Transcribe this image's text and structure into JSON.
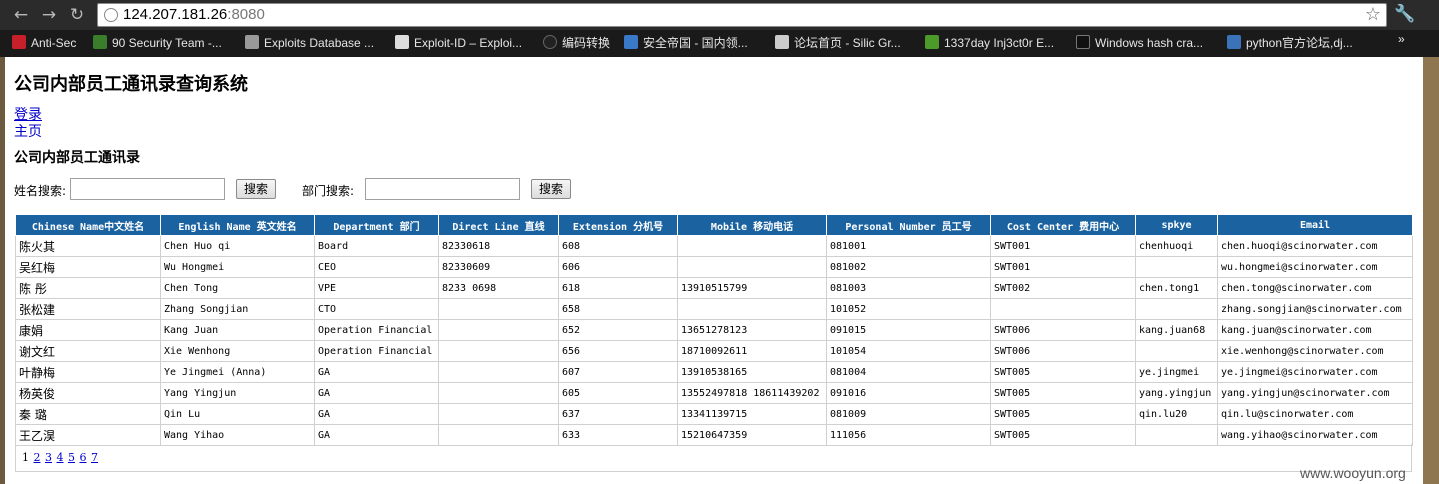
{
  "browser": {
    "url_host": "124.207.181.26",
    "url_port": ":8080",
    "bookmarks": [
      {
        "label": "Anti-Sec",
        "color": "#c8202a"
      },
      {
        "label": "90 Security Team -...",
        "color": "#3a7d2a"
      },
      {
        "label": "Exploits Database ...",
        "color": "#999999"
      },
      {
        "label": "Exploit-ID – Exploi...",
        "color": "#dddddd"
      },
      {
        "label": "编码转换",
        "color": "#222222"
      },
      {
        "label": "安全帝国 - 国内领...",
        "color": "#3a78c8"
      },
      {
        "label": "论坛首页 - Silic Gr...",
        "color": "#cccccc"
      },
      {
        "label": "1337day Inj3ct0r E...",
        "color": "#4c9a2a"
      },
      {
        "label": "Windows hash cra...",
        "color": "#111111"
      },
      {
        "label": "python官方论坛,dj...",
        "color": "#3b73b8"
      }
    ],
    "more": "»"
  },
  "page": {
    "title": "公司内部员工通讯录查询系统",
    "login_link": "登录",
    "home_link": "主页",
    "subtitle": "公司内部员工通讯录",
    "name_search_label": "姓名搜索:",
    "dept_search_label": "部门搜索:",
    "search_button": "搜索",
    "search_button2": "搜索"
  },
  "table": {
    "headers": [
      "Chinese Name中文姓名",
      "English Name 英文姓名",
      "Department 部门",
      "Direct Line 直线",
      "Extension 分机号",
      "Mobile 移动电话",
      "Personal Number 员工号",
      "Cost Center 费用中心",
      "spkye",
      "Email"
    ],
    "rows": [
      [
        "陈火其",
        "Chen Huo qi",
        "Board",
        "82330618",
        "608",
        "",
        "081001",
        "SWT001",
        "chenhuoqi",
        "chen.huoqi@scinorwater.com"
      ],
      [
        "吴红梅",
        "Wu Hongmei",
        "CEO",
        "82330609",
        "606",
        "",
        "081002",
        "SWT001",
        "",
        "wu.hongmei@scinorwater.com"
      ],
      [
        "陈 彤",
        "Chen Tong",
        "VPE",
        "8233 0698",
        "618",
        "13910515799",
        "081003",
        "SWT002",
        "chen.tong1",
        "chen.tong@scinorwater.com"
      ],
      [
        "张松建",
        "Zhang Songjian",
        "CTO",
        "",
        "658",
        "",
        "101052",
        "",
        "",
        "zhang.songjian@scinorwater.com"
      ],
      [
        "康娟",
        "Kang Juan",
        "Operation Financial",
        "",
        "652",
        "13651278123",
        "091015",
        "SWT006",
        "kang.juan68",
        "kang.juan@scinorwater.com"
      ],
      [
        "谢文红",
        "Xie Wenhong",
        "Operation Financial",
        "",
        "656",
        "18710092611",
        "101054",
        "SWT006",
        "",
        "xie.wenhong@scinorwater.com"
      ],
      [
        "叶静梅",
        "Ye Jingmei (Anna)",
        "GA",
        "",
        "607",
        "13910538165",
        "081004",
        "SWT005",
        "ye.jingmei",
        "ye.jingmei@scinorwater.com"
      ],
      [
        "杨英俊",
        "Yang Yingjun",
        "GA",
        "",
        "605",
        "13552497818 18611439202",
        "091016",
        "SWT005",
        "yang.yingjun",
        "yang.yingjun@scinorwater.com"
      ],
      [
        "秦 璐",
        "Qin Lu",
        "GA",
        "",
        "637",
        "13341139715",
        "081009",
        "SWT005",
        "qin.lu20",
        "qin.lu@scinorwater.com"
      ],
      [
        "王乙淏",
        "Wang Yihao",
        "GA",
        "",
        "633",
        "15210647359",
        "111056",
        "SWT005",
        "",
        "wang.yihao@scinorwater.com"
      ]
    ]
  },
  "pager": {
    "current": "1",
    "pages": [
      "2",
      "3",
      "4",
      "5",
      "6",
      "7"
    ]
  },
  "watermark": "www.wooyun.org"
}
